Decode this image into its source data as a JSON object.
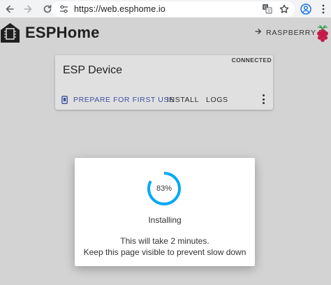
{
  "browser": {
    "url": "https://web.esphome.io",
    "icons": [
      "back-arrow-icon",
      "forward-arrow-icon",
      "reload-icon",
      "site-settings-icon",
      "translate-icon",
      "bookmark-star-icon",
      "profile-icon",
      "menu-kebab-icon"
    ]
  },
  "header": {
    "brand": "ESPHome",
    "secrets_label": "RASPBERRY PI"
  },
  "device_card": {
    "status": "CONNECTED",
    "title": "ESP Device",
    "actions": {
      "prepare": "PREPARE FOR FIRST USE",
      "install": "INSTALL",
      "logs": "LOGS"
    }
  },
  "dialog": {
    "progress": 83,
    "progress_label": "83%",
    "title": "Installing",
    "line1": "This will take 2 minutes.",
    "line2": "Keep this page visible to prevent slow down"
  },
  "colors": {
    "accent": "#03a9f4",
    "link": "#3d50a0",
    "raspberry": "#c51a4a"
  }
}
